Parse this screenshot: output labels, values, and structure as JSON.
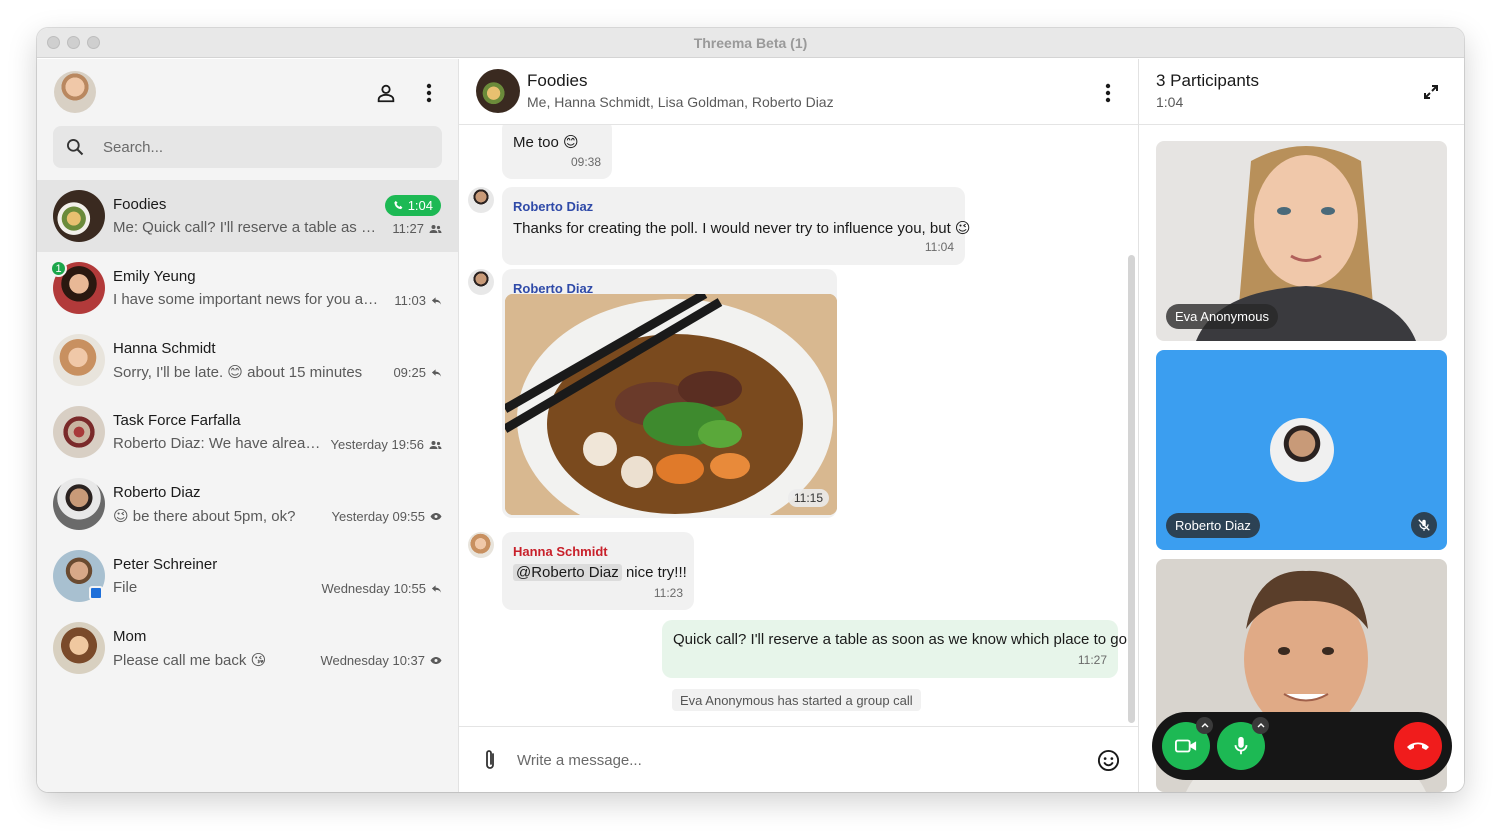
{
  "window": {
    "title": "Threema Beta (1)"
  },
  "sidebar": {
    "search_placeholder": "Search...",
    "chats": [
      {
        "name": "Foodies",
        "preview": "Me: Quick call? I'll reserve a table as soo...",
        "time": "11:27",
        "status_icon": "group-icon",
        "call_duration": "1:04",
        "active": true
      },
      {
        "name": "Emily Yeung",
        "preview": "I have some important news for you and ...",
        "time": "11:03",
        "status_icon": "reply-icon",
        "unread": "1"
      },
      {
        "name": "Hanna Schmidt",
        "preview": "Sorry, I'll be late. 😊 about 15 minutes",
        "time": "09:25",
        "status_icon": "reply-icon"
      },
      {
        "name": "Task Force Farfalla",
        "preview": "Roberto Diaz: We have already ...",
        "time": "Yesterday 19:56",
        "status_icon": "group-icon"
      },
      {
        "name": "Roberto Diaz",
        "preview": "😉 be there about 5pm, ok?",
        "time": "Yesterday 09:55",
        "status_icon": "eye-icon"
      },
      {
        "name": "Peter Schreiner",
        "preview": "File",
        "time": "Wednesday 10:55",
        "status_icon": "reply-icon"
      },
      {
        "name": "Mom",
        "preview": "Please call me back 😘",
        "time": "Wednesday 10:37",
        "status_icon": "eye-icon"
      }
    ]
  },
  "chat": {
    "title": "Foodies",
    "members": "Me, Hanna Schmidt, Lisa Goldman, Roberto Diaz",
    "messages": [
      {
        "text": "Me too 😊",
        "time": "09:38"
      },
      {
        "sender": "Roberto Diaz",
        "text": "Thanks for creating the poll. I would never try to influence you, but 😉",
        "time": "11:04"
      },
      {
        "sender": "Roberto Diaz",
        "image": "noodle-soup-photo",
        "time": "11:15"
      },
      {
        "sender": "Hanna Schmidt",
        "mention": "@Roberto Diaz",
        "text": "nice try!!!",
        "time": "11:23"
      },
      {
        "text": "Quick call? I'll reserve a table as soon as we know which place to go",
        "time": "11:27",
        "outgoing": true
      }
    ],
    "system_note": "Eva Anonymous has started a group call",
    "composer_placeholder": "Write a message..."
  },
  "call": {
    "title": "3 Participants",
    "duration": "1:04",
    "participants": [
      {
        "name": "Eva Anonymous"
      },
      {
        "name": "Roberto Diaz",
        "muted": true
      },
      {
        "name": ""
      }
    ]
  },
  "colors": {
    "accent_green": "#1db954",
    "end_call_red": "#f01c1c",
    "tile_blue": "#3b9ef0",
    "sender_blue": "#2f4aa8",
    "sender_red": "#c8202a",
    "outgoing_bubble": "#e7f5ea"
  }
}
